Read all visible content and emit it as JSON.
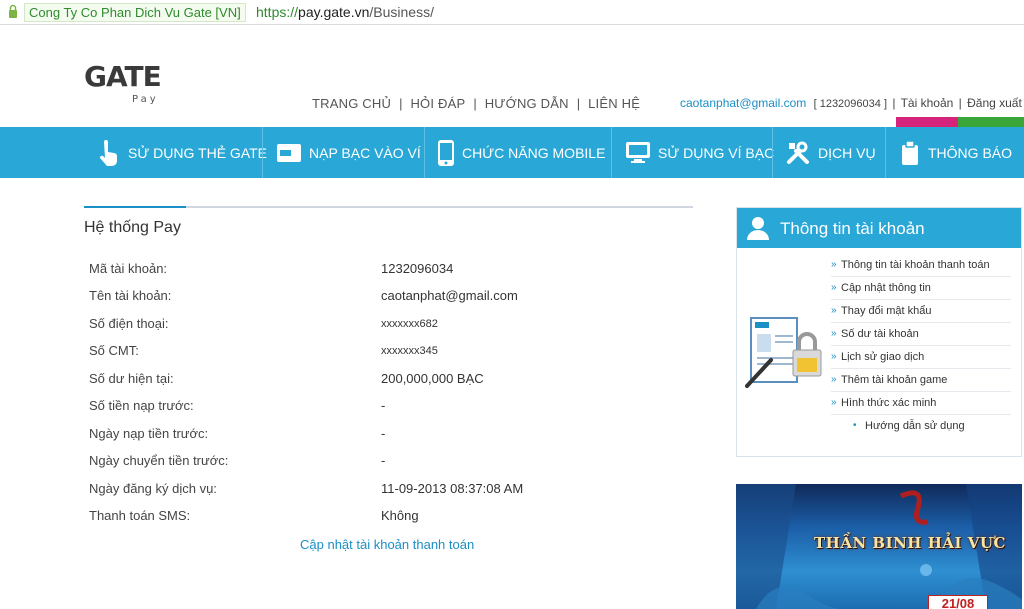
{
  "browser": {
    "cert_label": "Cong Ty Co Phan Dich Vu Gate [VN]",
    "url_scheme": "https://",
    "url_host": "pay.gate.vn",
    "url_path": "/Business/"
  },
  "header": {
    "logo_text": "GATE",
    "logo_sub": "Pay",
    "nav": [
      "TRANG CHỦ",
      "HỎI ĐÁP",
      "HƯỚNG DẪN",
      "LIÊN HỆ"
    ],
    "user_email": "caotanphat@gmail.com",
    "user_id": "[ 1232096034 ]",
    "account_link": "Tài khoản",
    "logout_link": "Đăng xuất"
  },
  "main_nav": [
    {
      "label": "SỬ DỤNG THẺ GATE",
      "icon": "hand-pointer-icon"
    },
    {
      "label": "NẠP BẠC VÀO VÍ",
      "icon": "gate-card-icon"
    },
    {
      "label": "CHỨC NĂNG MOBILE",
      "icon": "mobile-phone-icon"
    },
    {
      "label": "SỬ DỤNG VÍ BẠC",
      "icon": "monitor-icon"
    },
    {
      "label": "DỊCH VỤ",
      "icon": "tools-icon"
    },
    {
      "label": "THÔNG BÁO",
      "icon": "notice-icon"
    }
  ],
  "account": {
    "title": "Hệ thống Pay",
    "rows": [
      {
        "k": "Mã tài khoản:",
        "v": "1232096034"
      },
      {
        "k": "Tên tài khoản:",
        "v": "caotanphat@gmail.com"
      },
      {
        "k": "Số điện thoại:",
        "v": "xxxxxxx682"
      },
      {
        "k": "Số CMT:",
        "v": "xxxxxxx345"
      },
      {
        "k": "Số dư hiện tại:",
        "v": "200,000,000 BẠC"
      },
      {
        "k": "Số tiền nạp trước:",
        "v": "-"
      },
      {
        "k": "Ngày nạp tiền trước:",
        "v": "-"
      },
      {
        "k": "Ngày chuyển tiền trước:",
        "v": "-"
      },
      {
        "k": "Ngày đăng ký dịch vụ:",
        "v": "11-09-2013 08:37:08 AM"
      },
      {
        "k": "Thanh toán SMS:",
        "v": "Không"
      }
    ],
    "update_link": "Cập nhật tài khoản thanh toán"
  },
  "sidebar": {
    "title": "Thông tin tài khoản",
    "items": [
      "Thông tin tài khoản thanh toán",
      "Cập nhật thông tin",
      "Thay đổi mật khẩu",
      "Số dư tài khoản",
      "Lịch sử giao dịch",
      "Thêm tài khoản game",
      "Hình thức xác minh",
      "Hướng dẫn sử dụng"
    ]
  },
  "banner": {
    "title": "THẦN BINH HẢI VỰC",
    "date": "21/08"
  },
  "colors": {
    "accent": "#29a8d8",
    "link": "#1b8fc6",
    "bar_pink": "#d6247d",
    "bar_green": "#3aa538"
  }
}
